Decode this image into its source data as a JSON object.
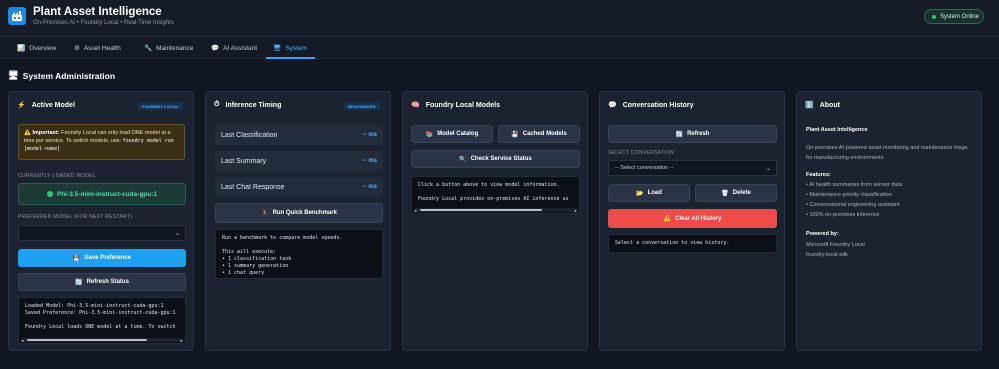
{
  "header": {
    "title": "Plant Asset Intelligence",
    "subtitle": "On-Premises AI • Foundry Local • Real-Time Insights",
    "status": "System Online",
    "logo_icon": "factory-icon"
  },
  "tabs": [
    {
      "label": "Overview",
      "icon": "chart-icon"
    },
    {
      "label": "Asset Health",
      "icon": "gear-icon"
    },
    {
      "label": "Maintenance",
      "icon": "wrench-icon"
    },
    {
      "label": "AI Assistant",
      "icon": "chat-icon"
    },
    {
      "label": "System",
      "icon": "monitor-icon",
      "active": true
    }
  ],
  "section_title": "System Administration",
  "active_model": {
    "title": "Active Model",
    "badge": "FOUNDRY LOCAL",
    "warning_bold": "Important:",
    "warning_text": "Foundry Local can only load ONE model at a time per service. To switch models, use:",
    "warning_code": "foundry model run [model-name]",
    "loaded_label": "CURRENTLY LOADED MODEL",
    "loaded_model": "Phi-3.5-mini-instruct-cuda-gpu:1",
    "preferred_label": "PREFERRED MODEL (FOR NEXT RESTART)",
    "preferred_value": "",
    "save_button": "Save Preference",
    "refresh_button": "Refresh Status",
    "console_lines": [
      "Loaded Model: Phi-3.5-mini-instruct-cuda-gpu:1",
      "Saved Preference: Phi-3.5-mini-instruct-cuda-gpu:1",
      "",
      "Foundry Local loads ONE model at a time. To switch"
    ]
  },
  "inference": {
    "title": "Inference Timing",
    "badge": "BENCHMARK",
    "rows": [
      {
        "label": "Last Classification",
        "value": "-- ms"
      },
      {
        "label": "Last Summary",
        "value": "-- ms"
      },
      {
        "label": "Last Chat Response",
        "value": "-- ms"
      }
    ],
    "button": "Run Quick Benchmark",
    "console_lines": [
      "Run a benchmark to compare model speeds.",
      "",
      "This will execute:",
      "• 1 classification task",
      "• 1 summary generation",
      "• 1 chat query"
    ]
  },
  "foundry_models": {
    "title": "Foundry Local Models",
    "catalog_button": "Model Catalog",
    "cached_button": "Cached Models",
    "check_button": "Check Service Status",
    "console_lines": [
      "Click a button above to view model information.",
      "",
      "Foundry Local provides on-premises AI inference us"
    ]
  },
  "history": {
    "title": "Conversation History",
    "refresh_button": "Refresh",
    "select_label": "SELECT CONVERSATION",
    "select_value": "-- Select conversation --",
    "load_button": "Load",
    "delete_button": "Delete",
    "clear_button": "Clear All History",
    "console_text": "Select a conversation to view history."
  },
  "about": {
    "title": "About",
    "app_name": "Plant Asset Intelligence",
    "description": "On-premises AI-powered asset monitoring and maintenance triage for manufacturing environments.",
    "features_label": "Features:",
    "features": [
      "• AI health summaries from sensor data",
      "• Maintenance priority classification",
      "• Conversational engineering assistant",
      "• 100% on-premises inference"
    ],
    "powered_label": "Powered by:",
    "powered": [
      "Microsoft Foundry Local",
      "foundry-local-sdk"
    ]
  },
  "colors": {
    "accent": "#1fa0f0",
    "danger": "#ef4a4a",
    "success": "#2ecc71",
    "background": "#111722",
    "card": "#1b2331"
  }
}
